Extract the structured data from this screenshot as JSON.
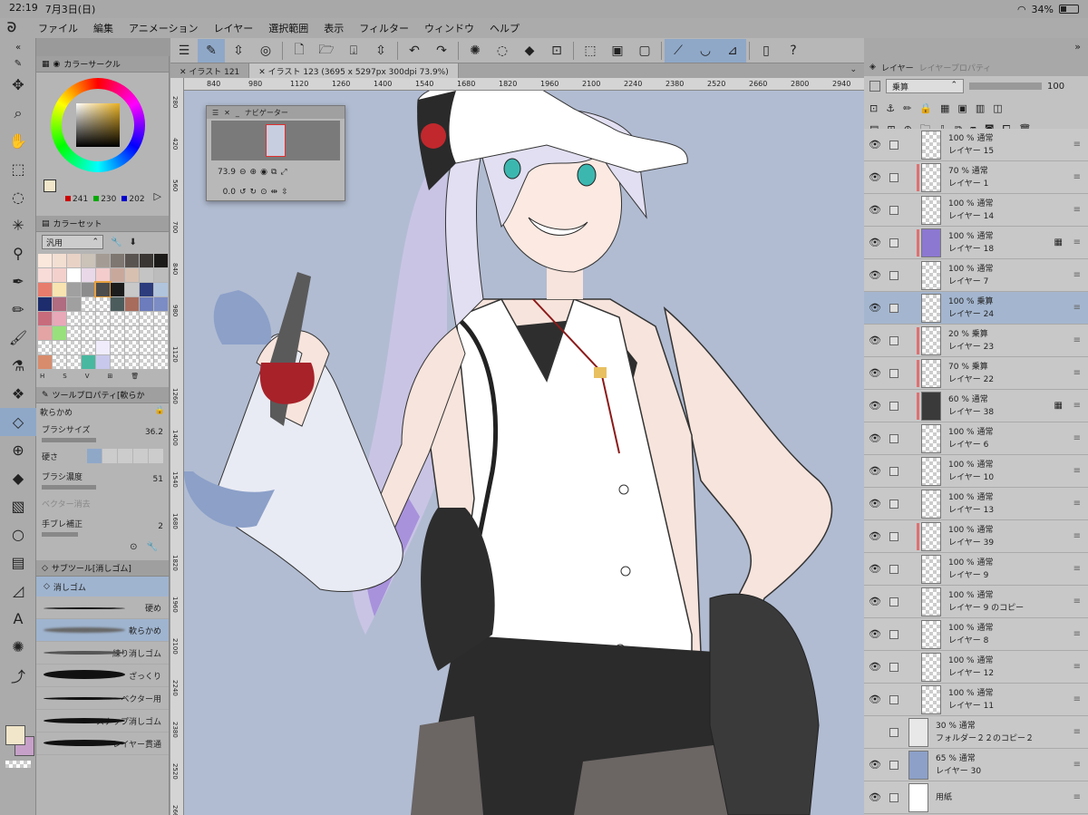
{
  "status": {
    "time": "22:19",
    "date": "7月3日(日)",
    "battery": "34%",
    "battery_level": 0.34
  },
  "menubar": {
    "items": [
      "ファイル",
      "編集",
      "アニメーション",
      "レイヤー",
      "選択範囲",
      "表示",
      "フィルター",
      "ウィンドウ",
      "ヘルプ"
    ]
  },
  "tabs": [
    {
      "label": "イラスト 121"
    },
    {
      "label": "イラスト 123 (3695 x 5297px 300dpi 73.9%)"
    }
  ],
  "ruler": {
    "h": [
      "840",
      "980",
      "1120",
      "1260",
      "1400",
      "1540",
      "1680",
      "1820",
      "1960",
      "2100",
      "2240",
      "2380",
      "2520",
      "2660",
      "2800",
      "2940"
    ],
    "v": [
      "280",
      "420",
      "560",
      "700",
      "840",
      "980",
      "1120",
      "1260",
      "1400",
      "1540",
      "1680",
      "1820",
      "1960",
      "2100",
      "2240",
      "2380",
      "2520",
      "2660"
    ]
  },
  "navigator": {
    "title": "ナビゲーター",
    "zoom": "73.9",
    "angle": "0.0"
  },
  "color_circle": {
    "title": "カラーサークル",
    "r": "241",
    "g": "230",
    "b": "202",
    "main_color": "#f1e6ca",
    "sub_color": "#c6a0c8"
  },
  "color_set": {
    "title": "カラーセット",
    "preset": "汎用",
    "swatches": [
      "#fbe8dc",
      "#f3ded2",
      "#e8d2c6",
      "#cbc2b8",
      "#a49c94",
      "#7e7670",
      "#5a5450",
      "#3a3634",
      "#1c1a18",
      "#f8dcd8",
      "#f4d0cc",
      "#ffffff",
      "#e8d8e8",
      "#f4cccc",
      "#c9a89c",
      "#d8c0b0",
      "#c4c4c4",
      "#bcbcbc",
      "#e87c6c",
      "#f8e4b0",
      "#a0a0a0",
      "#8c8c8c",
      "#4c4c4c",
      "#1c1c1c",
      "#c8c8c8",
      "#2c3c7c",
      "#b0c4dc",
      "#1c2c6c",
      "#b06c80",
      "#a0a0a0",
      "checker",
      "checker",
      "#4c5c5c",
      "#a86c5c",
      "#6c7cbc",
      "#7c8cc4",
      "#c86c7c",
      "#e8a8b8",
      "checker",
      "checker",
      "checker",
      "checker",
      "checker",
      "checker",
      "checker",
      "#e4a4a4",
      "#98e07c",
      "checker",
      "checker",
      "checker",
      "checker",
      "checker",
      "checker",
      "checker",
      "checker",
      "checker",
      "checker",
      "checker",
      "#f0ecfc",
      "checker",
      "checker",
      "checker",
      "checker",
      "#d88c6c",
      "checker",
      "checker",
      "#48b8a0",
      "#c8c8ec",
      "checker",
      "checker",
      "checker",
      "checker"
    ],
    "footer": [
      "H",
      "S",
      "V"
    ]
  },
  "tool_property": {
    "title": "ツールプロパティ[軟らか",
    "tool_name": "軟らかめ",
    "brush_size_label": "ブラシサイズ",
    "brush_size": "36.2",
    "hardness_label": "硬さ",
    "density_label": "ブラシ濃度",
    "density": "51",
    "vector_label": "ベクター消去",
    "stabilization_label": "手ブレ補正",
    "stabilization": "2"
  },
  "subtool": {
    "title": "サブツール[消しゴム]",
    "group": "消しゴム",
    "items": [
      "硬め",
      "軟らかめ",
      "練り消しゴム",
      "ざっくり",
      "ベクター用",
      "スナップ消しゴム",
      "レイヤー貫通"
    ]
  },
  "layer_panel": {
    "tab_layer": "レイヤー",
    "tab_property": "レイヤープロパティ",
    "blend_mode": "乗算",
    "opacity": "100",
    "layers": [
      {
        "meta": "100 %  通常",
        "name": "レイヤー 15",
        "bar": "",
        "thumb": "checker",
        "sel": false,
        "mark": ""
      },
      {
        "meta": "70 %  通常",
        "name": "レイヤー 1",
        "bar": "#e07070",
        "thumb": "checker",
        "sel": false,
        "mark": ""
      },
      {
        "meta": "100 %  通常",
        "name": "レイヤー 14",
        "bar": "",
        "thumb": "checker",
        "sel": false,
        "mark": ""
      },
      {
        "meta": "100 %  通常",
        "name": "レイヤー 18",
        "bar": "#e07070",
        "thumb": "#8c78d0",
        "sel": false,
        "mark": "▦"
      },
      {
        "meta": "100 %  通常",
        "name": "レイヤー 7",
        "bar": "",
        "thumb": "checker",
        "sel": false,
        "mark": ""
      },
      {
        "meta": "100 %  乗算",
        "name": "レイヤー 24",
        "bar": "",
        "thumb": "checker",
        "sel": true,
        "mark": ""
      },
      {
        "meta": "20 %  乗算",
        "name": "レイヤー 23",
        "bar": "#e07070",
        "thumb": "checker",
        "sel": false,
        "mark": ""
      },
      {
        "meta": "70 %  乗算",
        "name": "レイヤー 22",
        "bar": "#e07070",
        "thumb": "checker",
        "sel": false,
        "mark": ""
      },
      {
        "meta": "60 %  通常",
        "name": "レイヤー 38",
        "bar": "#e07070",
        "thumb": "#3a3a3a",
        "sel": false,
        "mark": "▦"
      },
      {
        "meta": "100 %  通常",
        "name": "レイヤー 6",
        "bar": "",
        "thumb": "checker",
        "sel": false,
        "mark": ""
      },
      {
        "meta": "100 %  通常",
        "name": "レイヤー 10",
        "bar": "",
        "thumb": "checker",
        "sel": false,
        "mark": ""
      },
      {
        "meta": "100 %  通常",
        "name": "レイヤー 13",
        "bar": "",
        "thumb": "checker",
        "sel": false,
        "mark": ""
      },
      {
        "meta": "100 %  通常",
        "name": "レイヤー 39",
        "bar": "#e07070",
        "thumb": "checker",
        "sel": false,
        "mark": ""
      },
      {
        "meta": "100 %  通常",
        "name": "レイヤー 9",
        "bar": "",
        "thumb": "checker",
        "sel": false,
        "mark": ""
      },
      {
        "meta": "100 %  通常",
        "name": "レイヤー 9 のコピー",
        "bar": "",
        "thumb": "checker",
        "sel": false,
        "mark": ""
      },
      {
        "meta": "100 %  通常",
        "name": "レイヤー 8",
        "bar": "",
        "thumb": "checker",
        "sel": false,
        "mark": ""
      },
      {
        "meta": "100 %  通常",
        "name": "レイヤー 12",
        "bar": "",
        "thumb": "checker",
        "sel": false,
        "mark": ""
      },
      {
        "meta": "100 %  通常",
        "name": "レイヤー 11",
        "bar": "",
        "thumb": "checker",
        "sel": false,
        "mark": ""
      },
      {
        "meta": "30 %  通常",
        "name": "フォルダー２２のコピー２",
        "bar": "",
        "thumb": "#e8e8e8",
        "sel": false,
        "mark": "",
        "folder": true
      },
      {
        "meta": "65 %  通常",
        "name": "レイヤー 30",
        "bar": "",
        "thumb": "#8ca0c8",
        "sel": false,
        "mark": "",
        "folder": true
      },
      {
        "meta": "",
        "name": "用紙",
        "bar": "",
        "thumb": "#ffffff",
        "sel": false,
        "mark": "",
        "folder": true
      }
    ]
  }
}
